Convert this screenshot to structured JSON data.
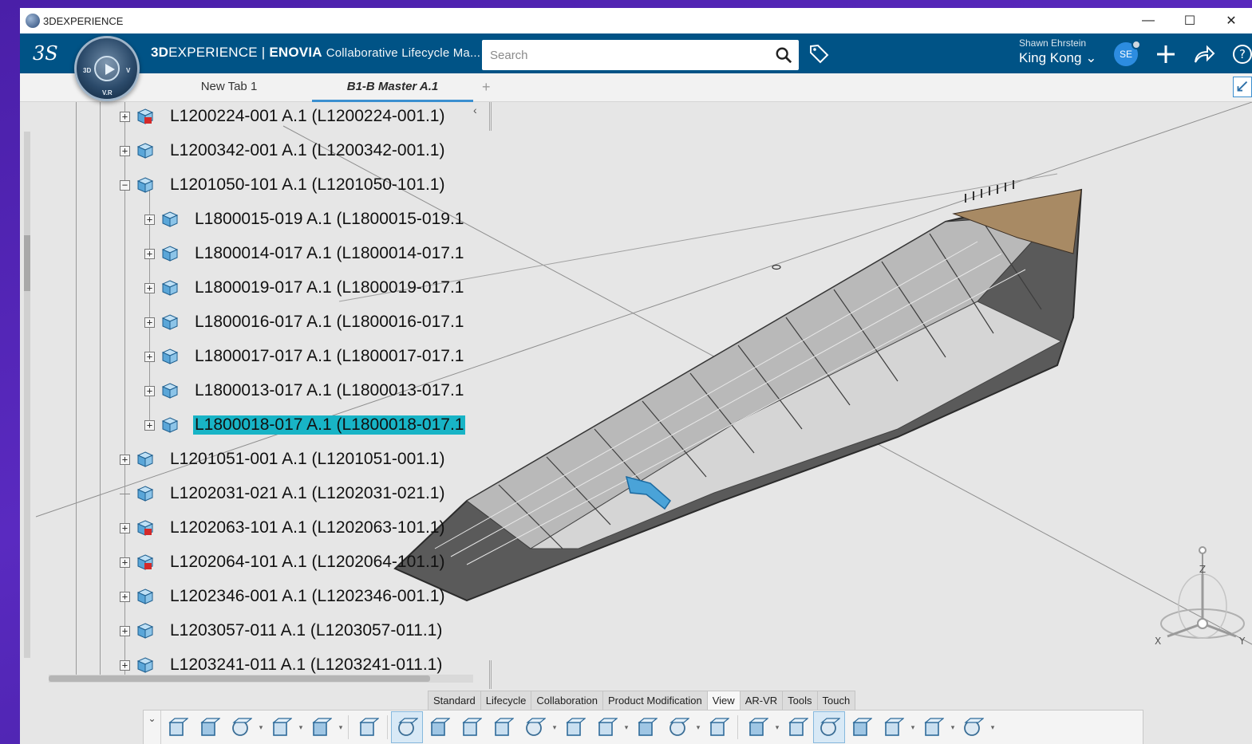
{
  "window": {
    "os_title": "3DEXPERIENCE",
    "controls": [
      "minimize",
      "maximize",
      "close"
    ]
  },
  "topbar": {
    "brand_main": "3D",
    "brand_rest": "EXPERIENCE",
    "brand_sep": "|",
    "brand_app": "ENOVIA",
    "brand_sub": "Collaborative Lifecycle Ma...",
    "search_placeholder": "Search",
    "user_name": "Shawn Ehrstein",
    "user_space": "King Kong",
    "avatar_initials": "SE",
    "colors": {
      "bar": "#005386",
      "accent": "#3b8fd0",
      "selection": "#18b4c6"
    }
  },
  "compass": {
    "labels": [
      "3D",
      "V",
      "V.R"
    ]
  },
  "tabs": [
    {
      "label": "New Tab 1",
      "active": false
    },
    {
      "label": "B1-B Master A.1",
      "active": true
    }
  ],
  "tree": {
    "rows": [
      {
        "label": "L1200224-001 A.1 (L1200224-001.1)",
        "level": 1,
        "expander": "+",
        "icon": "red"
      },
      {
        "label": "L1200342-001 A.1 (L1200342-001.1)",
        "level": 1,
        "expander": "+",
        "icon": "blue"
      },
      {
        "label": "L1201050-101 A.1 (L1201050-101.1)",
        "level": 1,
        "expander": "-",
        "icon": "blue"
      },
      {
        "label": "L1800015-019 A.1 (L1800015-019.1",
        "level": 2,
        "expander": "+",
        "icon": "part"
      },
      {
        "label": "L1800014-017 A.1 (L1800014-017.1",
        "level": 2,
        "expander": "+",
        "icon": "part"
      },
      {
        "label": "L1800019-017 A.1 (L1800019-017.1",
        "level": 2,
        "expander": "+",
        "icon": "part"
      },
      {
        "label": "L1800016-017 A.1 (L1800016-017.1",
        "level": 2,
        "expander": "+",
        "icon": "part"
      },
      {
        "label": "L1800017-017 A.1 (L1800017-017.1",
        "level": 2,
        "expander": "+",
        "icon": "part"
      },
      {
        "label": "L1800013-017 A.1 (L1800013-017.1",
        "level": 2,
        "expander": "+",
        "icon": "part"
      },
      {
        "label": "L1800018-017 A.1 (L1800018-017.1",
        "level": 2,
        "expander": "+",
        "icon": "part",
        "selected": true
      },
      {
        "label": "L1201051-001 A.1 (L1201051-001.1)",
        "level": 1,
        "expander": "+",
        "icon": "blue"
      },
      {
        "label": "L1202031-021 A.1 (L1202031-021.1)",
        "level": 1,
        "expander": "",
        "icon": "blue"
      },
      {
        "label": "L1202063-101 A.1 (L1202063-101.1)",
        "level": 1,
        "expander": "+",
        "icon": "red"
      },
      {
        "label": "L1202064-101 A.1 (L1202064-101.1)",
        "level": 1,
        "expander": "+",
        "icon": "red"
      },
      {
        "label": "L1202346-001 A.1 (L1202346-001.1)",
        "level": 1,
        "expander": "+",
        "icon": "blue"
      },
      {
        "label": "L1203057-011 A.1 (L1203057-011.1)",
        "level": 1,
        "expander": "+",
        "icon": "blue"
      },
      {
        "label": "L1203241-011 A.1 (L1203241-011.1)",
        "level": 1,
        "expander": "+",
        "icon": "blue"
      }
    ]
  },
  "axes": {
    "x": "X",
    "y": "Y",
    "z": "Z"
  },
  "action_bar": {
    "tabs": [
      "Standard",
      "Lifecycle",
      "Collaboration",
      "Product Modification",
      "View",
      "AR-VR",
      "Tools",
      "Touch"
    ],
    "active_tab": "View",
    "tools": [
      "cut-icon",
      "copy-icon",
      "paste-icon",
      "undo-icon",
      "update-icon",
      "zoom-fit-icon",
      "view-cube-icon",
      "fit-all-icon",
      "pan-icon",
      "rotate-icon",
      "zoom-icon",
      "look-at-icon",
      "iso-view-icon",
      "shading-icon",
      "cylinder-icon",
      "render-icon",
      "hide-show-icon",
      "visualization-icon",
      "section-icon",
      "ambience-icon",
      "layout-icon",
      "tree-icon",
      "assembly-icon"
    ]
  }
}
